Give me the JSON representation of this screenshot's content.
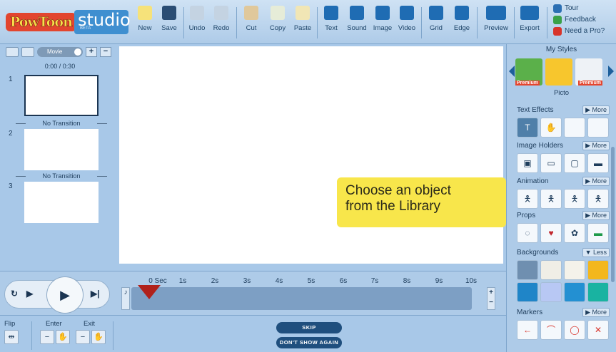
{
  "logo": {
    "pow": "PowToon",
    "studio": "studio",
    "beta": "BETA"
  },
  "toolbar": {
    "buttons": [
      {
        "label": "New",
        "icon": "new-icon"
      },
      {
        "label": "Save",
        "icon": "save-icon"
      },
      {
        "label": "Undo",
        "icon": "undo-icon"
      },
      {
        "label": "Redo",
        "icon": "redo-icon"
      },
      {
        "label": "Cut",
        "icon": "scissors-icon"
      },
      {
        "label": "Copy",
        "icon": "copy-icon"
      },
      {
        "label": "Paste",
        "icon": "paste-icon"
      },
      {
        "label": "Text",
        "icon": "text-icon"
      },
      {
        "label": "Sound",
        "icon": "sound-icon"
      },
      {
        "label": "Image",
        "icon": "image-icon"
      },
      {
        "label": "Video",
        "icon": "video-icon"
      },
      {
        "label": "Grid",
        "icon": "grid-icon"
      },
      {
        "label": "Edge",
        "icon": "edge-icon"
      },
      {
        "label": "Preview",
        "icon": "eye-icon"
      },
      {
        "label": "Export",
        "icon": "export-icon"
      }
    ],
    "links": [
      {
        "label": "Tour",
        "color": "#2b6fb3"
      },
      {
        "label": "Feedback",
        "color": "#3aa148"
      },
      {
        "label": "Need a Pro?",
        "color": "#d8342b"
      }
    ]
  },
  "left_panel": {
    "mode_toggle": "Movie",
    "add": "+",
    "remove": "−",
    "time": "0:00 / 0:30",
    "slides": [
      "1",
      "2",
      "3"
    ],
    "transitions": [
      "No Transition",
      "No Transition"
    ]
  },
  "callout": {
    "line1": "Choose an object",
    "line2": "from the Library"
  },
  "right_panel": {
    "title": "My Styles",
    "premium": "Premium",
    "style_name": "Picto",
    "categories": [
      {
        "name": "Text Effects",
        "toggle": "▶ More"
      },
      {
        "name": "Image Holders",
        "toggle": "▶ More"
      },
      {
        "name": "Animation",
        "toggle": "▶ More"
      },
      {
        "name": "Props",
        "toggle": "▶ More"
      },
      {
        "name": "Backgrounds",
        "toggle": "▼ Less"
      },
      {
        "name": "Markers",
        "toggle": "▶ More"
      }
    ]
  },
  "timeline": {
    "ticks": [
      "0 Sec",
      "1s",
      "2s",
      "3s",
      "4s",
      "5s",
      "6s",
      "7s",
      "8s",
      "9s",
      "10s"
    ],
    "zoom_in": "+",
    "zoom_out": "−"
  },
  "bottom": {
    "flip": "Flip",
    "enter": "Enter",
    "exit": "Exit",
    "skip": "SKIP",
    "dont_show": "DON'T SHOW AGAIN"
  }
}
